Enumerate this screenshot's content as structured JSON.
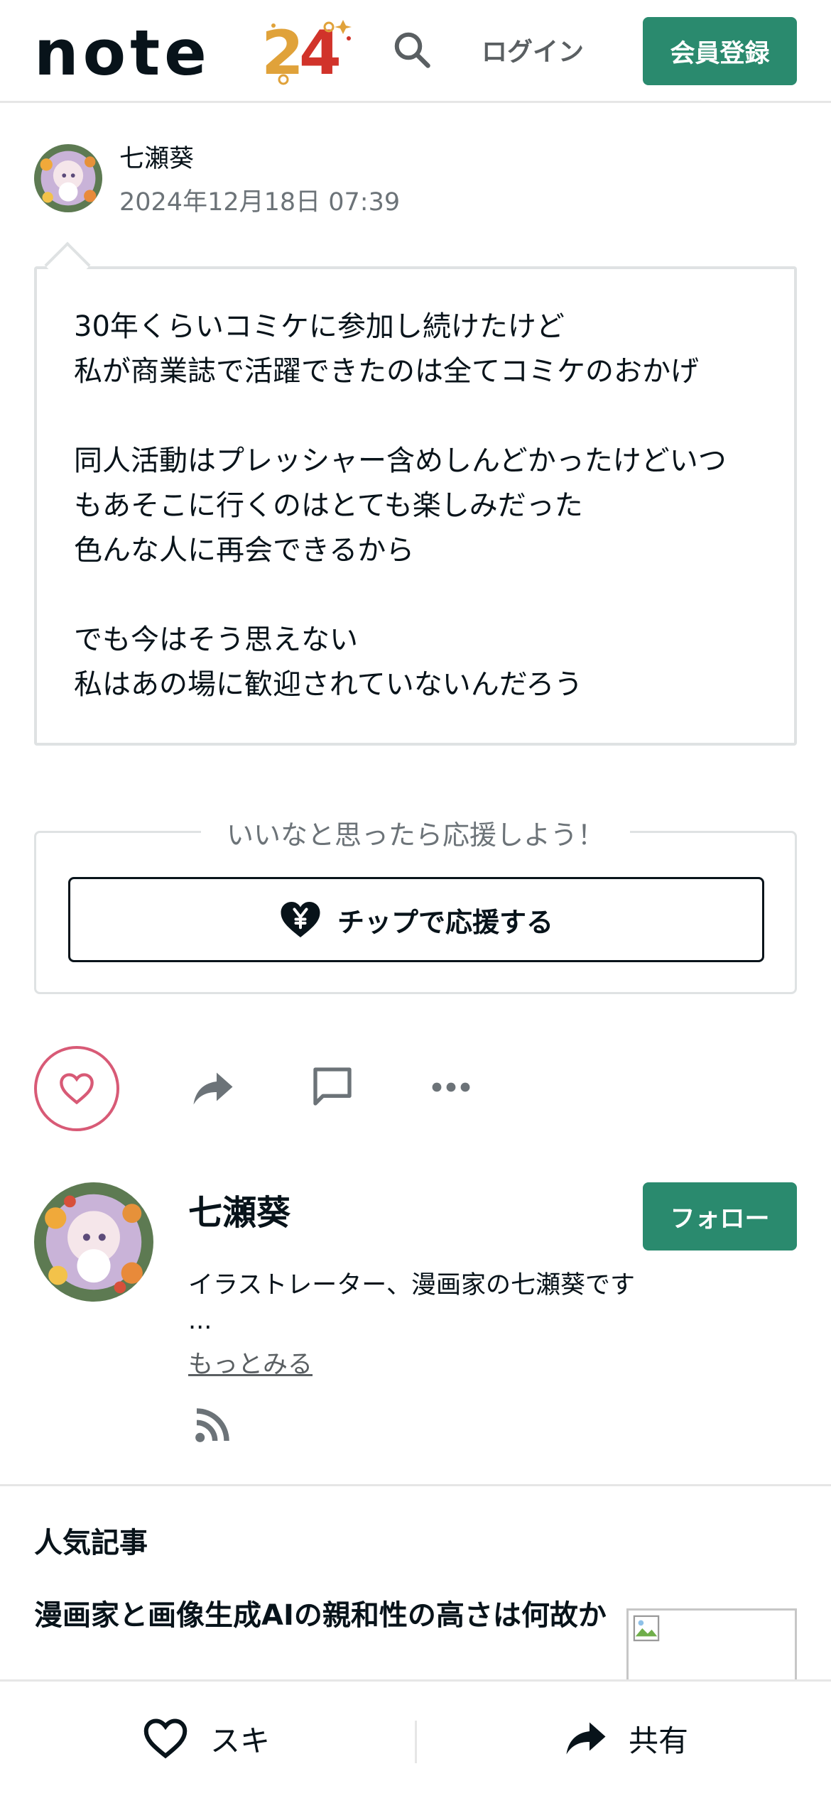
{
  "header": {
    "logo_text": "note",
    "logo_badge": "24",
    "login_label": "ログイン",
    "signup_label": "会員登録"
  },
  "post": {
    "author_name": "七瀬葵",
    "date": "2024年12月18日 07:39",
    "body": "30年くらいコミケに参加し続けたけど\n私が商業誌で活躍できたのは全てコミケのおかげ\n\n同人活動はプレッシャー含めしんどかったけどいつ\nもあそこに行くのはとても楽しみだった\n色んな人に再会できるから\n\nでも今はそう思えない\n私はあの場に歓迎されていないんだろう"
  },
  "tip": {
    "caption": "いいなと思ったら応援しよう！",
    "button_label": "チップで応援する"
  },
  "creator": {
    "name": "七瀬葵",
    "follow_label": "フォロー",
    "bio": "イラストレーター、漫画家の七瀬葵です",
    "bio_ellipsis": "...",
    "more_label": "もっとみる"
  },
  "popular": {
    "title": "人気記事",
    "articles": [
      {
        "title": "漫画家と画像生成AIの親和性の高さは何故か"
      }
    ]
  },
  "bottom_bar": {
    "like_label": "スキ",
    "share_label": "共有"
  },
  "colors": {
    "brand_green": "#2a8a6e",
    "like_pink": "#d85a76",
    "text_dark": "#08131a",
    "text_gray": "#6c7378"
  },
  "icons": [
    "search-icon",
    "heart-icon",
    "share-arrow-icon",
    "comment-icon",
    "more-dots-icon",
    "rss-icon",
    "yen-heart-icon",
    "broken-image-icon"
  ]
}
